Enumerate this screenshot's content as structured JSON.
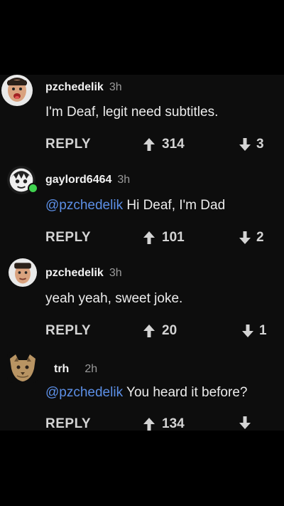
{
  "comments": [
    {
      "username": "pzchedelik",
      "time": "3h",
      "mention": "",
      "text": "I'm Deaf, legit need subtitles.",
      "reply_label": "REPLY",
      "upvotes": "314",
      "downvotes": "3"
    },
    {
      "username": "gaylord6464",
      "time": "3h",
      "mention": "@pzchedelik",
      "text": " Hi Deaf, I'm Dad",
      "reply_label": "REPLY",
      "upvotes": "101",
      "downvotes": "2"
    },
    {
      "username": "pzchedelik",
      "time": "3h",
      "mention": "",
      "text": "yeah yeah, sweet joke.",
      "reply_label": "REPLY",
      "upvotes": "20",
      "downvotes": "1"
    },
    {
      "username": "trh",
      "time": "2h",
      "mention": "@pzchedelik",
      "text": " You heard it before?",
      "reply_label": "REPLY",
      "upvotes": "134",
      "downvotes": ""
    }
  ],
  "colors": {
    "mention": "#5c8fe6",
    "online_status": "#3fd24f",
    "background": "#0d0d0d"
  },
  "icons": {
    "upvote": "arrow-up-icon",
    "downvote": "arrow-down-icon",
    "online": "online-status-dot"
  }
}
